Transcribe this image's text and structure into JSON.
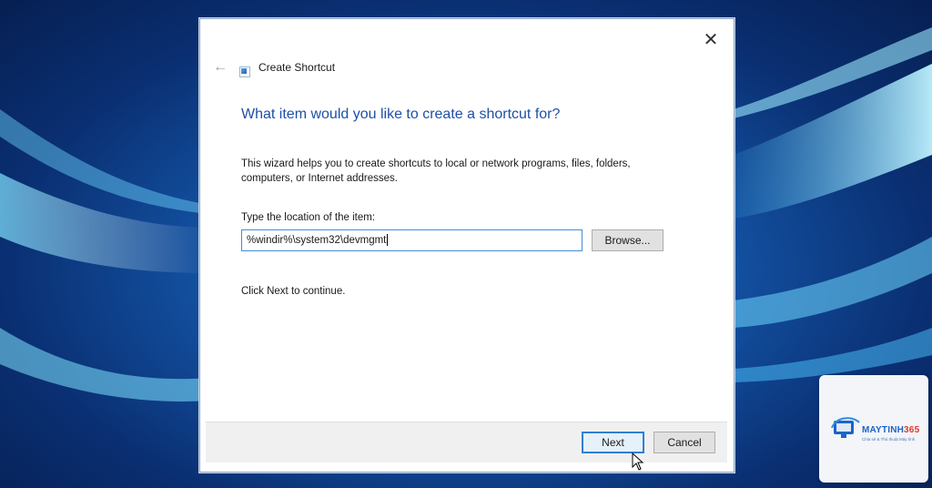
{
  "dialog": {
    "title": "Create Shortcut",
    "close_symbol": "✕",
    "back_symbol": "←",
    "heading": "What item would you like to create a shortcut for?",
    "description": "This wizard helps you to create shortcuts to local or network programs, files, folders, computers, or Internet addresses.",
    "location_label": "Type the location of the item:",
    "location_value": "%windir%\\system32\\devmgmt",
    "browse_label": "Browse...",
    "continue_text": "Click Next to continue.",
    "next_label": "Next",
    "cancel_label": "Cancel"
  },
  "watermark": {
    "brand_main": "MAYTINH",
    "brand_accent": "365",
    "tagline": "Chia sẻ & Thủ thuật Máy tính"
  },
  "colors": {
    "heading": "#1e4fa8",
    "focus_border": "#3f8fd8",
    "brand_blue": "#1e63c6",
    "brand_red": "#e23a2a"
  },
  "icons": [
    "close-icon",
    "back-arrow-icon",
    "shortcut-icon",
    "mouse-cursor-icon",
    "brand-logo-icon"
  ]
}
